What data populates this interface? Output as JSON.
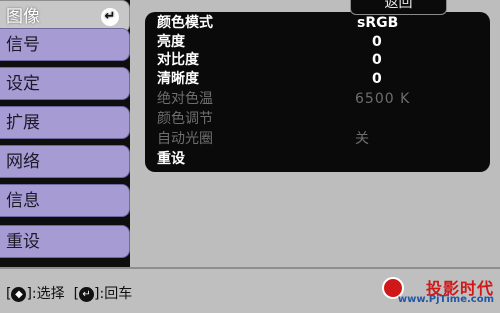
{
  "menu": {
    "items": [
      {
        "label": "图像",
        "active": true
      },
      {
        "label": "信号",
        "active": false
      },
      {
        "label": "设定",
        "active": false
      },
      {
        "label": "扩展",
        "active": false
      },
      {
        "label": "网络",
        "active": false
      },
      {
        "label": "信息",
        "active": false
      },
      {
        "label": "重设",
        "active": false
      }
    ],
    "enter_icon": "enter-icon"
  },
  "panel": {
    "back_label": "返回",
    "rows": [
      {
        "label": "颜色模式",
        "value": "sRGB",
        "enabled": true
      },
      {
        "label": "亮度",
        "value": "0",
        "enabled": true
      },
      {
        "label": "对比度",
        "value": "0",
        "enabled": true
      },
      {
        "label": "清晰度",
        "value": "0",
        "enabled": true
      },
      {
        "label": "绝对色温",
        "value": "6500 K",
        "enabled": false
      },
      {
        "label": "颜色调节",
        "value": "",
        "enabled": false
      },
      {
        "label": "自动光圈",
        "value": "关",
        "enabled": false
      },
      {
        "label": "重设",
        "value": "",
        "enabled": true
      }
    ]
  },
  "footer": {
    "select_bracket_open": "[",
    "select_key_icon": "◆",
    "select_hint": "]:选择",
    "enter_bracket_open": "[",
    "enter_key_icon": "↵",
    "enter_hint": "]:回车"
  },
  "watermark": {
    "title": "投影时代",
    "url": "www.PjTime.com"
  },
  "colors": {
    "menu_active": "#c7c7c7",
    "menu_inactive": "#a79bd3",
    "panel_bg": "#0a0a0a",
    "text_enabled": "#ffffff",
    "text_disabled": "#6e6e6e",
    "logo_red": "#d01818",
    "logo_blue": "#2456a6"
  }
}
